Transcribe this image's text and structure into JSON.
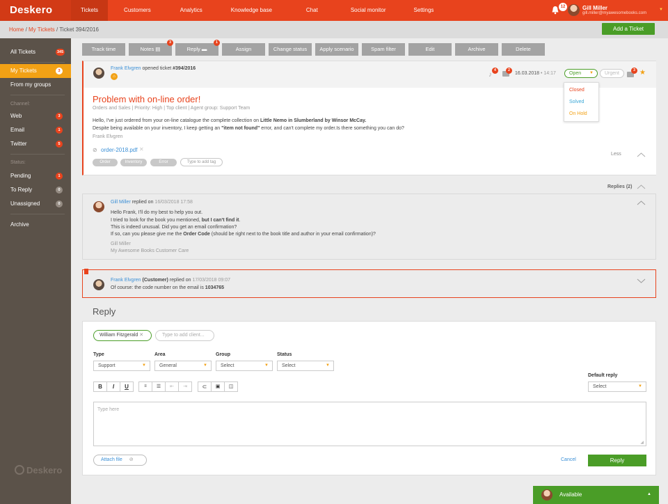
{
  "app": {
    "logo": "Deskero",
    "footer_logo": "Deskero"
  },
  "nav": [
    "Tickets",
    "Customers",
    "Analytics",
    "Knowledge base",
    "Chat",
    "Social monitor",
    "Settings"
  ],
  "user": {
    "notifications": "12",
    "name": "Gill Miller",
    "email": "gill.miller@myawesomebooks.com"
  },
  "breadcrumb": {
    "home": "Home",
    "sep1": " / ",
    "my_tickets": "My Tickets",
    "sep2": " / ",
    "current": "Ticket 394/2016"
  },
  "add_ticket": "Add a Ticket",
  "sidebar": {
    "all": {
      "label": "All Tickets",
      "count": "345"
    },
    "mine": {
      "label": "My Tickets",
      "count": "3"
    },
    "groups": "From my groups",
    "channel_heading": "Channel:",
    "web": {
      "label": "Web",
      "count": "3"
    },
    "email": {
      "label": "Email",
      "count": "1"
    },
    "twitter": {
      "label": "Twitter",
      "count": "5"
    },
    "status_heading": "Status:",
    "pending": {
      "label": "Pending",
      "count": "1"
    },
    "to_reply": {
      "label": "To Reply",
      "count": "0"
    },
    "unassigned": {
      "label": "Unassigned",
      "count": "0"
    },
    "archive": "Archive"
  },
  "toolbar": {
    "track_time": "Track time",
    "notes": "Notes",
    "notes_badge": "3",
    "reply": "Reply",
    "reply_badge": "1",
    "assign": "Assign",
    "change_status": "Change status",
    "apply_scenario": "Apply scenario",
    "spam_filter": "Spam filter",
    "edit": "Edit",
    "archive": "Archive",
    "delete": "Delete"
  },
  "ticket": {
    "author": "Frank Elvgren",
    "opened_text": " opened ticket ",
    "number": "#394/2016",
    "badge_a": "4",
    "badge_b": "2",
    "date": "16.03.2018",
    "time_sep": " • ",
    "time": "14:17",
    "status": "Open",
    "urgent": "Urgent",
    "comments": "3",
    "status_options": [
      "Closed",
      "Solved",
      "On Hold"
    ],
    "subject": "Problem with on-line order!",
    "meta_area": "Orders and Sales",
    "meta_sep": " | ",
    "meta_priority": "Priority: High",
    "meta_client": "Top client",
    "meta_group": "Agent group: Support Team",
    "body1_pre": "Hello, I've just ordered from your on-line catalogue the complete collection on ",
    "body1_bold": "Little Nemo in Slumberland by Winsor McCay.",
    "body2_pre": "Despite being available on your inventory, I keep getting an ",
    "body2_bold": "\"item not found\"",
    "body2_post": " error, and can't complete my order.Is there something you can do?",
    "signature": "Frank Elvgren",
    "attachment": "order-2018.pdf",
    "tags": [
      "Order",
      "Inventory",
      "Error"
    ],
    "tag_placeholder": "Type to add tag",
    "less": "Less"
  },
  "replies_label": "Replies (2)",
  "reply1": {
    "author": "Gill Miller",
    "replied_on": " replied on ",
    "datetime": "16/03/2018 17:58",
    "line1": "Hello Frank, I'll do my best to help you out.",
    "line2_pre": "I tried to look for the book you mentioned, ",
    "line2_bold": "but I can't find it",
    "line2_post": ".",
    "line3": "This is indeed unusual. Did you get an email confirmation?",
    "line4_pre": "If so, can you please give me the ",
    "line4_bold": "Order Code",
    "line4_post": " (should be right next to the book title and author in your email confirmation)?",
    "sig1": "Gill Miller",
    "sig2": "My Awesome Books Customer Care"
  },
  "reply2": {
    "author": "Frank Elvgren",
    "role": " (Customer)",
    "replied_on": " replied on ",
    "datetime": "17/03/2018 09:07",
    "line_pre": "Of course: the code number on the email is ",
    "line_bold": "1034765"
  },
  "form": {
    "heading": "Reply",
    "recipient": "William Fitzgerald",
    "client_placeholder": "Type to add client...",
    "type_label": "Type",
    "type_value": "Support",
    "area_label": "Area",
    "area_value": "General",
    "group_label": "Group",
    "group_value": "Select",
    "status_label": "Status",
    "status_value": "Select",
    "default_reply_label": "Default reply",
    "default_reply_value": "Select",
    "editor_placeholder": "Type here",
    "attach": "Attach file",
    "cancel": "Cancel",
    "reply": "Reply"
  },
  "availability": "Available",
  "colors": {
    "brand": "#e8431d",
    "sidebar": "#5b5249",
    "accent": "#f2a115",
    "success": "#4a9d27",
    "link": "#3a8fd6"
  }
}
